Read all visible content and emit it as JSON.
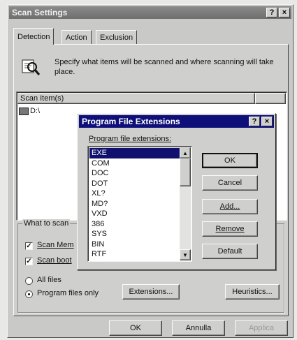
{
  "window": {
    "title": "Scan Settings",
    "help_glyph": "?",
    "close_glyph": "×"
  },
  "tabs": [
    {
      "label": "Detection",
      "active": true
    },
    {
      "label": "Action",
      "active": false
    },
    {
      "label": "Exclusion",
      "active": false
    }
  ],
  "detection": {
    "description": "Specify what items will be scanned and where scanning will take place.",
    "scan_items_header": "Scan Item(s)",
    "scan_items": [
      "D:\\"
    ],
    "what_to_scan_legend": "What to scan",
    "scan_memory_label": "Scan Mem",
    "scan_memory_checked": true,
    "scan_boot_label": "Scan boot",
    "scan_boot_checked": true,
    "all_files_label": "All files",
    "program_files_label": "Program files only",
    "selected_file_mode": "program_files",
    "extensions_button": "Extensions...",
    "heuristics_button": "Heuristics..."
  },
  "footer": {
    "ok": "OK",
    "cancel": "Annulla",
    "apply": "Applica"
  },
  "dialog": {
    "title": "Program File Extensions",
    "help_glyph": "?",
    "close_glyph": "×",
    "list_label": "Program file extensions:",
    "extensions": [
      "EXE",
      "COM",
      "DOC",
      "DOT",
      "XL?",
      "MD?",
      "VXD",
      "386",
      "SYS",
      "BIN",
      "RTF"
    ],
    "selected_extension": "EXE",
    "ok": "OK",
    "cancel": "Cancel",
    "add": "Add...",
    "remove": "Remove",
    "default": "Default"
  },
  "colors": {
    "titlebar_inactive": "#777777",
    "titlebar_active": "#0f0f7a",
    "selection": "#10106e",
    "face": "#cfcfcd"
  }
}
